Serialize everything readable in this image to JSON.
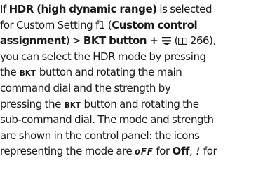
{
  "text": {
    "l1a": "If ",
    "l1b": "HDR (high dynamic range)",
    "l1c": " is selected",
    "l2a": "for Custom Setting f1 (",
    "l2b": "Custom control",
    "l3a": "assignment",
    "l3b": ") > ",
    "l3c": "BKT button + ",
    "l3d": " (",
    "l3e": " 266),",
    "l4": "you can select the HDR mode by pressing",
    "l5a": "the ",
    "l5b": "BKT",
    "l5c": " button and rotating the main",
    "l6": "command dial and the strength by",
    "l7a": "pressing the ",
    "l7b": "BKT",
    "l7c": " button and rotating the",
    "l8": "sub-command dial. The mode and strength",
    "l9": "are shown in the control panel: the icons",
    "l10a": "representing the mode are ",
    "l10b": "oFF",
    "l10c": " for ",
    "l10d": "Off",
    "l10e": ", ",
    "l10f": "!",
    "l10g": " for"
  },
  "icons": {
    "bracket": "bracket-icon",
    "reference": "book-reference-icon"
  }
}
